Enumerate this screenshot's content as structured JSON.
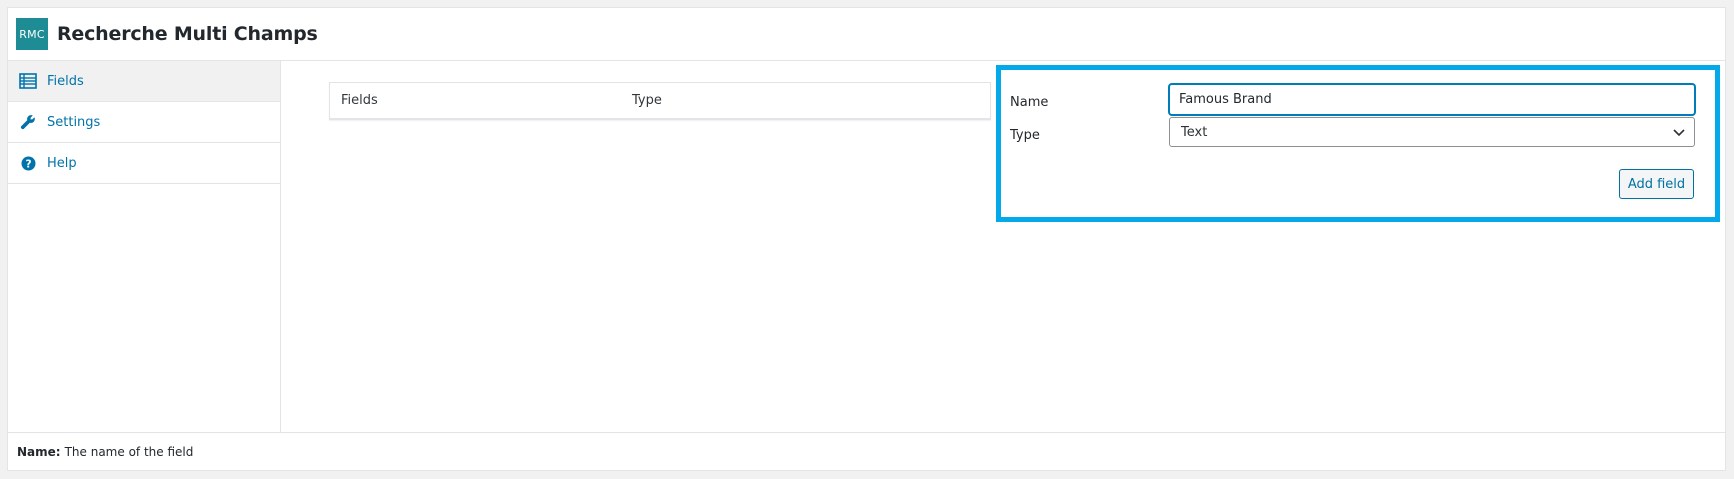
{
  "header": {
    "logo_text": "RMC",
    "title": "Recherche Multi Champs"
  },
  "sidebar": {
    "items": [
      {
        "label": "Fields",
        "icon": "list-icon",
        "active": true
      },
      {
        "label": "Settings",
        "icon": "wrench-icon",
        "active": false
      },
      {
        "label": "Help",
        "icon": "help-circle-icon",
        "active": false
      }
    ]
  },
  "table": {
    "columns": [
      "Fields",
      "Type"
    ]
  },
  "form": {
    "name_label": "Name",
    "name_value": "Famous Brand",
    "type_label": "Type",
    "type_value": "Text",
    "add_button": "Add field"
  },
  "footer": {
    "term": "Name:",
    "description": "The name of the field"
  },
  "colors": {
    "accent": "#0073aa",
    "highlight_border": "#03a9e8",
    "logo_bg": "#1e8c94"
  }
}
